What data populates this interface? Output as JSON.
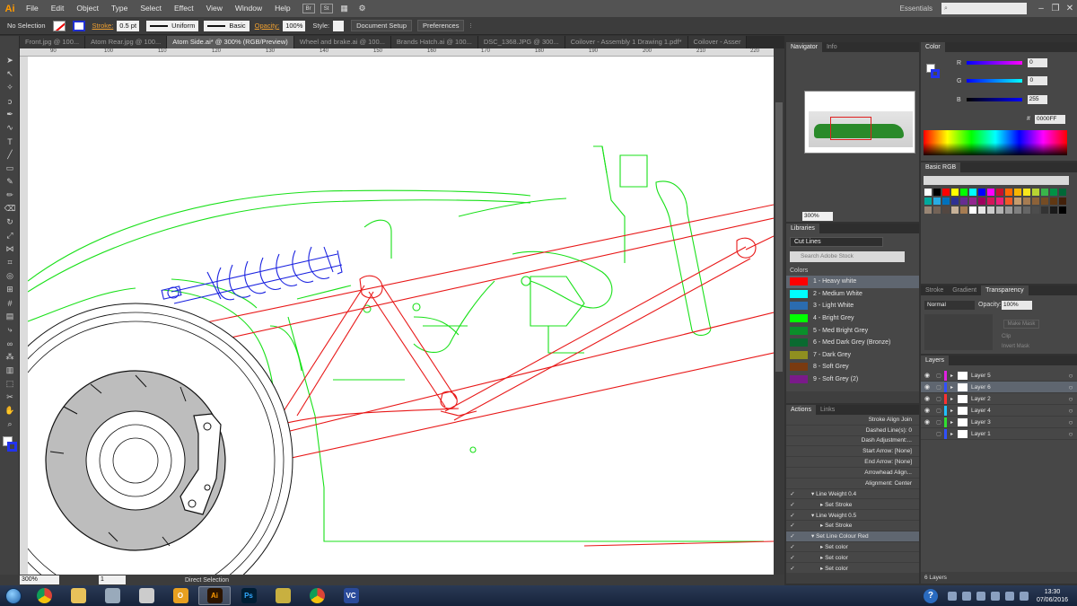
{
  "app": {
    "logo": "Ai"
  },
  "menu": [
    "File",
    "Edit",
    "Object",
    "Type",
    "Select",
    "Effect",
    "View",
    "Window",
    "Help"
  ],
  "menu_buttons": [
    "Br",
    "St"
  ],
  "workspace": {
    "name": "Essentials",
    "search_placeholder": ""
  },
  "control": {
    "selection": "No Selection",
    "stroke_label": "Stroke:",
    "stroke_weight": "0.5 pt",
    "profile": "Uniform",
    "brush": "Basic",
    "opacity_label": "Opacity:",
    "opacity": "100%",
    "style_label": "Style:",
    "doc_setup": "Document Setup",
    "preferences": "Preferences"
  },
  "tabs": [
    {
      "label": "Front.jpg @ 100...",
      "active": false
    },
    {
      "label": "Atom Rear.jpg @ 100...",
      "active": false
    },
    {
      "label": "Atom Side.ai* @ 300% (RGB/Preview)",
      "active": true
    },
    {
      "label": "Wheel and brake.ai @ 100...",
      "active": false
    },
    {
      "label": "Brands Hatch.ai @ 100...",
      "active": false
    },
    {
      "label": "DSC_1368.JPG @ 300...",
      "active": false
    },
    {
      "label": "Coilover - Assembly 1 Drawing 1.pdf*",
      "active": false
    },
    {
      "label": "Coilover - Asser",
      "active": false
    }
  ],
  "ruler": [
    "90",
    "100",
    "110",
    "120",
    "130",
    "140",
    "150",
    "160",
    "170",
    "180",
    "190",
    "200",
    "210",
    "220"
  ],
  "status": {
    "zoom": "300%",
    "page": "1",
    "tool": "Direct Selection"
  },
  "navigator": {
    "tabs": [
      "Navigator",
      "Info"
    ],
    "zoom": "300%"
  },
  "libraries": {
    "title": "Libraries",
    "library": "Cut Lines",
    "search_placeholder": "Search Adobe Stock",
    "section": "Colors",
    "colors": [
      {
        "name": "1 - Heavy white",
        "hex": "#ff0000"
      },
      {
        "name": "2 - Medium White",
        "hex": "#00ffff"
      },
      {
        "name": "3 - Light White",
        "hex": "#2b6cb0"
      },
      {
        "name": "4 - Bright Grey",
        "hex": "#00ff00"
      },
      {
        "name": "5 - Med Bright Grey",
        "hex": "#0a8f2a"
      },
      {
        "name": "6 - Med Dark Grey (Bronze)",
        "hex": "#0a6a30"
      },
      {
        "name": "7 - Dark Grey",
        "hex": "#8f8f20"
      },
      {
        "name": "8 - Soft Grey",
        "hex": "#7a3a10"
      },
      {
        "name": "9 - Soft Grey (2)",
        "hex": "#7a1a8a"
      }
    ]
  },
  "actions": {
    "tabs": [
      "Actions",
      "Links"
    ],
    "rows": [
      {
        "label": "Stroke Align Join",
        "indent": 3,
        "check": false
      },
      {
        "label": "Dashed Line(s): 0",
        "indent": 3,
        "check": false
      },
      {
        "label": "Dash Adjustment:...",
        "indent": 3,
        "check": false
      },
      {
        "label": "Start Arrow: [None]",
        "indent": 3,
        "check": false
      },
      {
        "label": "End Arrow: [None]",
        "indent": 3,
        "check": false
      },
      {
        "label": "Arrowhead Align...",
        "indent": 3,
        "check": false
      },
      {
        "label": "Alignment: Center",
        "indent": 3,
        "check": false
      },
      {
        "label": "Line Weight 0.4",
        "indent": 1,
        "check": true
      },
      {
        "label": "Set Stroke",
        "indent": 2,
        "check": true
      },
      {
        "label": "Line Weight 0.5",
        "indent": 1,
        "check": true
      },
      {
        "label": "Set Stroke",
        "indent": 2,
        "check": true
      },
      {
        "label": "Set Line Colour Red",
        "indent": 1,
        "check": true,
        "selected": true
      },
      {
        "label": "Set color",
        "indent": 2,
        "check": true
      },
      {
        "label": "Set color",
        "indent": 2,
        "check": true
      },
      {
        "label": "Set color",
        "indent": 2,
        "check": true
      }
    ]
  },
  "color": {
    "title": "Color",
    "r_label": "R",
    "g_label": "G",
    "b_label": "B",
    "r": "0",
    "g": "0",
    "b": "255",
    "hex_label": "#",
    "hex": "0000FF"
  },
  "swatches": {
    "title": "Basic RGB",
    "colors": [
      "#ffffff",
      "#000000",
      "#ff0000",
      "#ffff00",
      "#00ff00",
      "#00ffff",
      "#0000ff",
      "#ff00ff",
      "#c8102e",
      "#ff6a00",
      "#f7b500",
      "#f8e71c",
      "#b7d433",
      "#39b54a",
      "#009245",
      "#006837",
      "#00a99d",
      "#29abe2",
      "#0071bc",
      "#2e3192",
      "#662d91",
      "#93278f",
      "#9e005d",
      "#d4145a",
      "#ed1e79",
      "#f15a24",
      "#c69c6d",
      "#a67c52",
      "#8c6239",
      "#754c24",
      "#603813",
      "#42210b",
      "#998675",
      "#736357",
      "#534741",
      "#c7b299",
      "#a67c52",
      "#ffffff",
      "#e6e6e6",
      "#cccccc",
      "#b3b3b3",
      "#999999",
      "#808080",
      "#666666",
      "#4d4d4d",
      "#333333",
      "#1a1a1a",
      "#000000"
    ]
  },
  "transparency": {
    "tabs": [
      "Stroke",
      "Gradient",
      "Transparency"
    ],
    "mode": "Normal",
    "opacity_label": "Opacity:",
    "opacity": "100%",
    "make_mask": "Make Mask",
    "clip": "Clip",
    "invert": "Invert Mask"
  },
  "layers": {
    "title": "Layers",
    "rows": [
      {
        "name": "Layer 5",
        "color": "#e020e0",
        "visible": true,
        "selected": false
      },
      {
        "name": "Layer 6",
        "color": "#3050ff",
        "visible": true,
        "selected": true
      },
      {
        "name": "Layer 2",
        "color": "#ff3030",
        "visible": true,
        "selected": false
      },
      {
        "name": "Layer 4",
        "color": "#20c0ff",
        "visible": true,
        "selected": false
      },
      {
        "name": "Layer 3",
        "color": "#30e030",
        "visible": true,
        "selected": false
      },
      {
        "name": "Layer 1",
        "color": "#3050ff",
        "visible": false,
        "selected": false
      }
    ],
    "count": "6 Layers"
  },
  "taskbar": {
    "apps": [
      {
        "name": "chrome",
        "label": "",
        "bg": "#e8e8e8",
        "fg": "#d33",
        "active": false
      },
      {
        "name": "explorer",
        "label": "",
        "bg": "#e8c25a",
        "fg": "#fff",
        "active": false
      },
      {
        "name": "network",
        "label": "",
        "bg": "#9ab",
        "fg": "#fff",
        "active": false
      },
      {
        "name": "remote",
        "label": "",
        "bg": "#ccc",
        "fg": "#333",
        "active": false
      },
      {
        "name": "outlook",
        "label": "O",
        "bg": "#e8a020",
        "fg": "#fff",
        "active": false
      },
      {
        "name": "illustrator",
        "label": "Ai",
        "bg": "#2b1400",
        "fg": "#ff9a00",
        "active": true
      },
      {
        "name": "photoshop",
        "label": "Ps",
        "bg": "#001d33",
        "fg": "#31a8ff",
        "active": false
      },
      {
        "name": "folder",
        "label": "",
        "bg": "#c8b040",
        "fg": "#fff",
        "active": false
      },
      {
        "name": "chrome2",
        "label": "",
        "bg": "#e8e8e8",
        "fg": "#d33",
        "active": false
      },
      {
        "name": "vjc",
        "label": "VC",
        "bg": "#2a4a9a",
        "fg": "#fff",
        "active": false
      }
    ],
    "time": "13:30",
    "date": "07/06/2016"
  }
}
